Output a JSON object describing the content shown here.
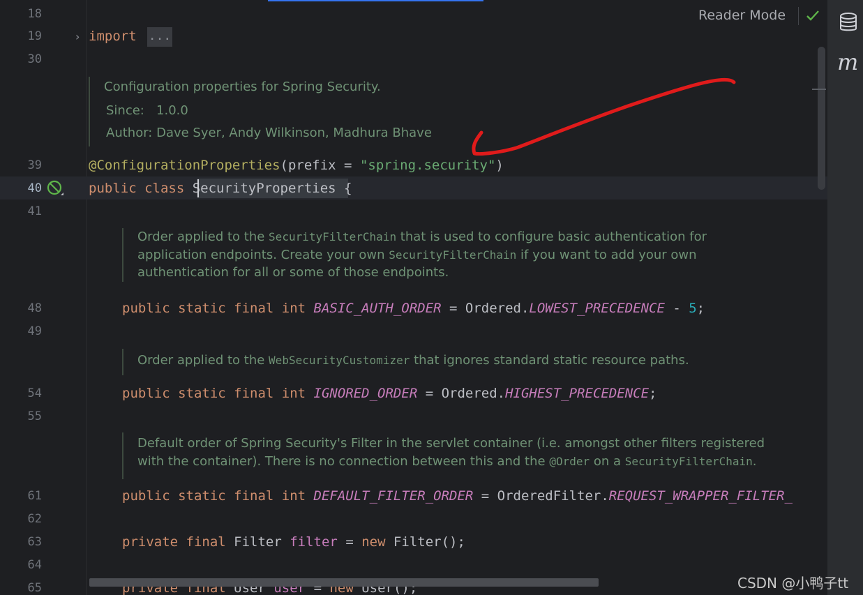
{
  "line_numbers": {
    "l18": "18",
    "l19": "19",
    "l30": "30",
    "l39": "39",
    "l40": "40",
    "l41": "41",
    "l48": "48",
    "l49": "49",
    "l54": "54",
    "l55": "55",
    "l61": "61",
    "l62": "62",
    "l63": "63",
    "l64": "64",
    "l65": "65"
  },
  "toolbar": {
    "reader_mode_label": "Reader Mode"
  },
  "fold": {
    "import_keyword": "import",
    "import_placeholder": "..."
  },
  "class_doc": {
    "summary": "Configuration properties for Spring Security.",
    "since_label": "Since:",
    "since_value": "1.0.0",
    "author_label": "Author:",
    "author_value": "Dave Syer, Andy Wilkinson, Madhura Bhave"
  },
  "annotation_line": {
    "annotation": "@ConfigurationProperties",
    "open": "(prefix = ",
    "value": "\"spring.security\"",
    "close": ")"
  },
  "class_line": {
    "kw": "public class ",
    "name": "SecurityProperties",
    "brace": " {"
  },
  "doc_basic_auth": {
    "t1": "Order applied to the ",
    "c1": "SecurityFilterChain",
    "t2": " that is used to configure basic authentication for",
    "t3": "application endpoints. Create your own ",
    "c2": "SecurityFilterChain",
    "t4": " if you want to add your own",
    "t5": "authentication for all or some of those endpoints."
  },
  "line48": {
    "mods": "public static final int ",
    "name": "BASIC_AUTH_ORDER",
    "eq": " = Ordered.",
    "ref": "LOWEST_PRECEDENCE",
    "minus": " - ",
    "num": "5",
    "end": ";"
  },
  "doc_ignored": {
    "t1": "Order applied to the ",
    "c1": "WebSecurityCustomizer",
    "t2": " that ignores standard static resource paths."
  },
  "line54": {
    "mods": "public static final int ",
    "name": "IGNORED_ORDER",
    "eq": " = Ordered.",
    "ref": "HIGHEST_PRECEDENCE",
    "end": ";"
  },
  "doc_filter": {
    "t1": "Default order of Spring Security's Filter in the servlet container (i.e. amongst other filters registered",
    "t2": "with the container). There is no connection between this and the ",
    "c1": "@Order",
    "t3": " on a ",
    "c2": "SecurityFilterChain",
    "t4": "."
  },
  "line61": {
    "mods": "public static final int ",
    "name": "DEFAULT_FILTER_ORDER",
    "eq": " = OrderedFilter.",
    "ref": "REQUEST_WRAPPER_FILTER_"
  },
  "line63": {
    "mods": "private final ",
    "type": "Filter ",
    "name": "filter",
    "eq": " = ",
    "new": "new ",
    "ctor": "Filter();"
  },
  "line65": {
    "mods": "private final ",
    "type": "User ",
    "name": "user",
    "eq": " = ",
    "new": "new ",
    "ctor": "User();"
  },
  "watermark": "CSDN @小鸭子tt",
  "colors": {
    "accent": "#3574f0",
    "annotation_arrow": "#e01b1b",
    "keyword": "#cf8e6d",
    "string": "#6aab73",
    "constant": "#c77dbb"
  }
}
